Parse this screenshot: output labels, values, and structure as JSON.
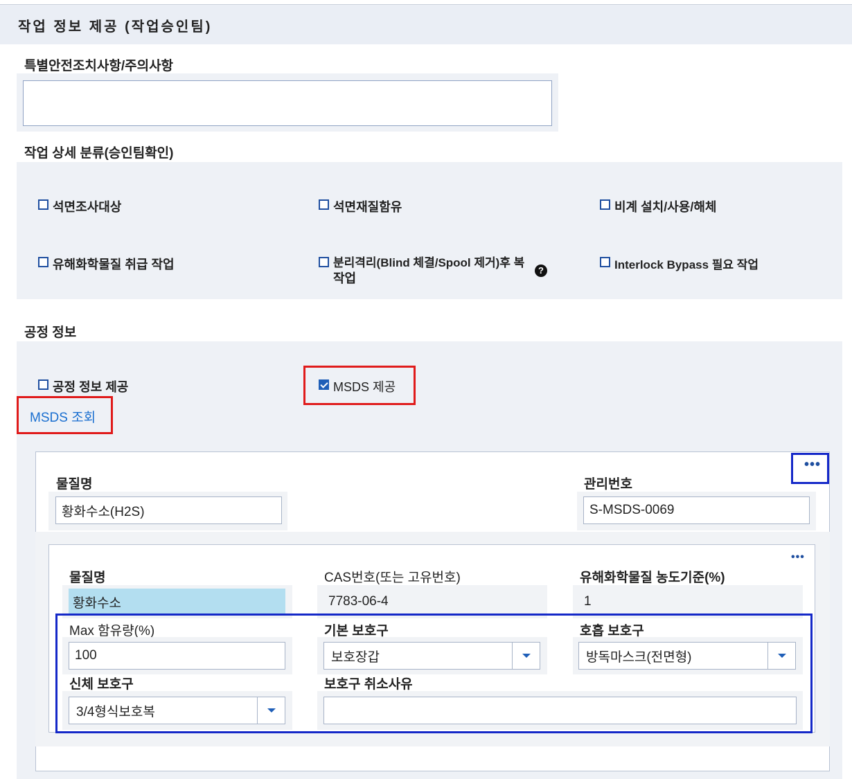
{
  "header": {
    "title": "작업 정보 제공 (작업승인팀)"
  },
  "special_safety": {
    "label": "특별안전조치사항/주의사항",
    "value": ""
  },
  "detail_category": {
    "label": "작업 상세 분류(승인팀확인)",
    "items": [
      {
        "label": "석면조사대상",
        "checked": false
      },
      {
        "label": "석면재질함유",
        "checked": false
      },
      {
        "label": "비계 설치/사용/해체",
        "checked": false
      },
      {
        "label": "유해화학물질 취급 작업",
        "checked": false
      },
      {
        "label": "분리격리(Blind 체결/Spool 제거)후 복",
        "label_line2": "작업",
        "checked": false
      },
      {
        "label": "Interlock Bypass 필요 작업",
        "checked": false
      }
    ],
    "help_icon": "question-circle-icon"
  },
  "process_info": {
    "label": "공정 정보",
    "provide_process": {
      "label": "공정 정보 제공",
      "checked": false
    },
    "provide_msds": {
      "label": "MSDS 제공",
      "checked": true
    },
    "msds_link": "MSDS 조회"
  },
  "msds_card": {
    "more_icon": "more-dots-icon",
    "material_label": "물질명",
    "material_value": "황화수소(H2S)",
    "mgmt_label": "관리번호",
    "mgmt_value": "S-MSDS-0069",
    "inner": {
      "more_icon": "more-dots-icon",
      "material_label": "물질명",
      "material_value": "황화수소",
      "cas_label": "CAS번호(또는 고유번호)",
      "cas_value": "7783-06-4",
      "threshold_label": "유해화학물질 농도기준(%)",
      "threshold_value": "1",
      "max_label": "Max 함유량(%)",
      "max_value": "100",
      "basic_ppe_label": "기본 보호구",
      "basic_ppe_value": "보호장갑",
      "resp_ppe_label": "호흡 보호구",
      "resp_ppe_value": "방독마스크(전면형)",
      "body_ppe_label": "신체 보호구",
      "body_ppe_value": "3/4형식보호복",
      "cancel_reason_label": "보호구 취소사유",
      "cancel_reason_value": ""
    }
  },
  "colors": {
    "accent": "#1f5fb8",
    "highlight_red": "#e01b1b",
    "highlight_blue": "#1428c8",
    "selected_cell": "#b3def0"
  }
}
